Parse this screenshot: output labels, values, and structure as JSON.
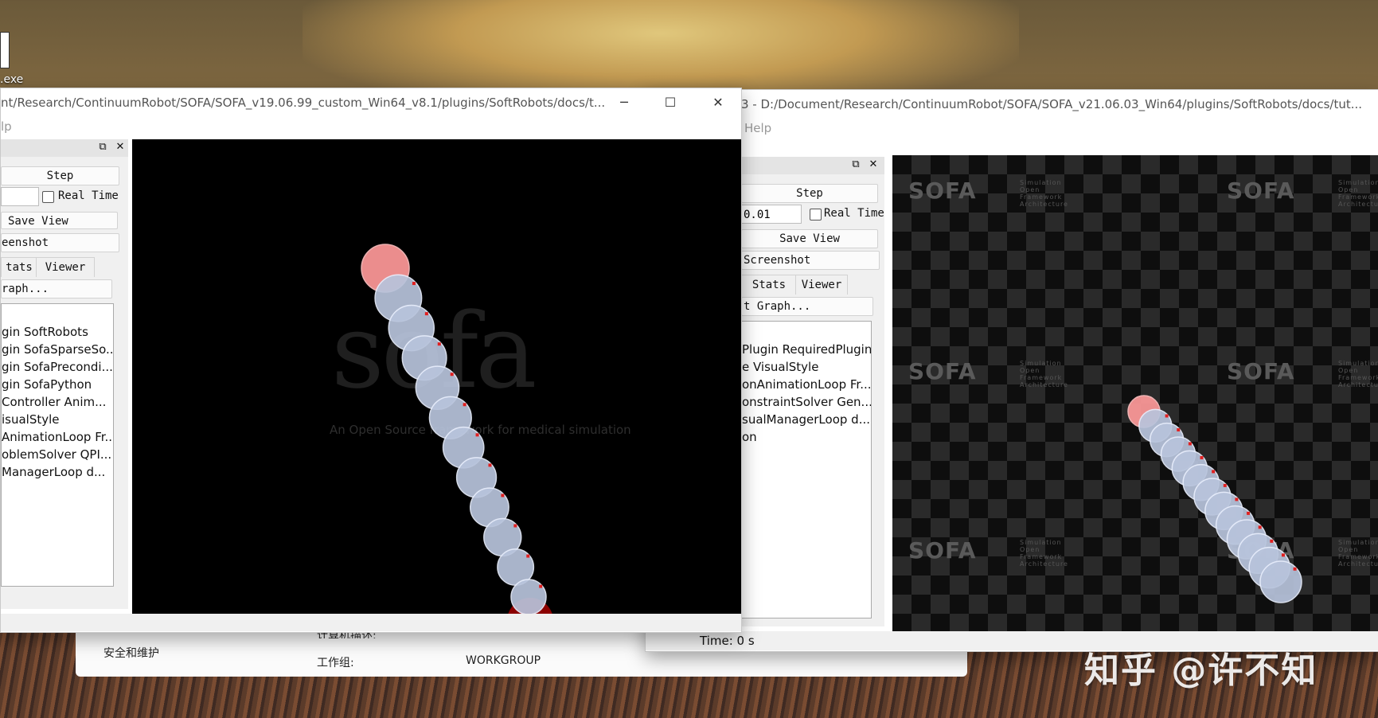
{
  "desktop": {
    "exe_label": ".exe",
    "watermark": "知乎 @许不知"
  },
  "control_panel": {
    "security_item": "安全和维护",
    "computer_desc_label": "计算机描述:",
    "workgroup_label": "工作组:",
    "workgroup_value": "WORKGROUP"
  },
  "left_window": {
    "title": "nt/Research/ContinuumRobot/SOFA/SOFA_v19.06.99_custom_Win64_v8.1/plugins/SoftRobots/docs/t...",
    "menu_help": "lp",
    "controls": {
      "step": "Step",
      "dt_value": "",
      "real_time": "Real Time",
      "save_view": "Save View",
      "screenshot": "eenshot"
    },
    "tabs": [
      "tats",
      "Viewer"
    ],
    "graph_button": "raph...",
    "tree_items": [
      "gin SoftRobots",
      "gin SofaSparseSo...",
      "gin SofaPrecondi...",
      "gin SofaPython",
      "Controller Anim...",
      "isualStyle",
      "AnimationLoop Fr...",
      "oblemSolver QPI...",
      "ManagerLoop d..."
    ],
    "viewer": {
      "logo": "sofa",
      "tagline": "An Open Source framework for medical simulation"
    }
  },
  "right_window": {
    "title": "3 - D:/Document/Research/ContinuumRobot/SOFA/SOFA_v21.06.03_Win64/plugins/SoftRobots/docs/tut...",
    "menu_help": "Help",
    "controls": {
      "step": "Step",
      "dt_value": "0.01",
      "real_time": "Real Time",
      "save_view": "Save View",
      "screenshot": "Screenshot"
    },
    "tabs": [
      "Stats",
      "Viewer"
    ],
    "graph_button": "t Graph...",
    "tree_items": [
      "Plugin RequiredPlugin",
      "e VisualStyle",
      "onAnimationLoop Fr...",
      "onstraintSolver Gen...",
      "sualManagerLoop d...",
      "on"
    ],
    "status_time": "Time: 0 s",
    "viewer": {
      "watermark": "SOFA",
      "watermark_sub": "Simulation Open Framework Architecture"
    }
  },
  "icons": {
    "minimize": "─",
    "maximize": "☐",
    "close": "✕",
    "float": "⧉"
  },
  "colors": {
    "robot_segment": "#b8c4dc",
    "robot_tip": "#ff9a9a",
    "anchor_ball": "#8b0000"
  }
}
